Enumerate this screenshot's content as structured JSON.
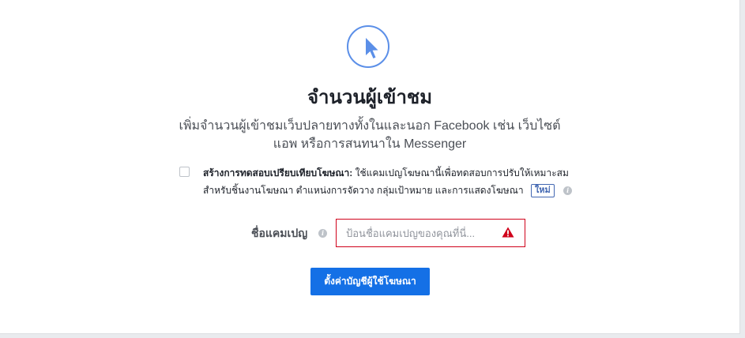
{
  "objective": {
    "icon": "cursor-pointer-icon",
    "title": "จำนวนผู้เข้าชม",
    "description": "เพิ่มจำนวนผู้เข้าชมเว็บปลายทางทั้งในและนอก Facebook เช่น เว็บไซต์ แอพ หรือการสนทนาใน Messenger"
  },
  "ab_test": {
    "checked": false,
    "title": "สร้างการทดสอบเปรียบเทียบโฆษณา:",
    "text_line1": "ใช้แคมเปญโฆษณานี้เพื่อทดสอบการปรับให้เหมาะสม",
    "text_line2": "สำหรับชิ้นงานโฆษณา ตำแหน่งการจัดวาง กลุ่มเป้าหมาย และการแสดงโฆษณา",
    "badge": "ใหม่",
    "info_icon": "info-icon"
  },
  "campaign_name": {
    "label": "ชื่อแคมเปญ",
    "value": "",
    "placeholder": "ป้อนชื่อแคมเปญของคุณที่นี่...",
    "error_icon": "warning-icon",
    "error_color": "#d0021b"
  },
  "cta": {
    "label": "ตั้งค่าบัญชีผู้ใช้โฆษณา"
  },
  "colors": {
    "accent": "#1470e6",
    "icon_blue": "#5b8fe8",
    "error": "#d0021b"
  }
}
